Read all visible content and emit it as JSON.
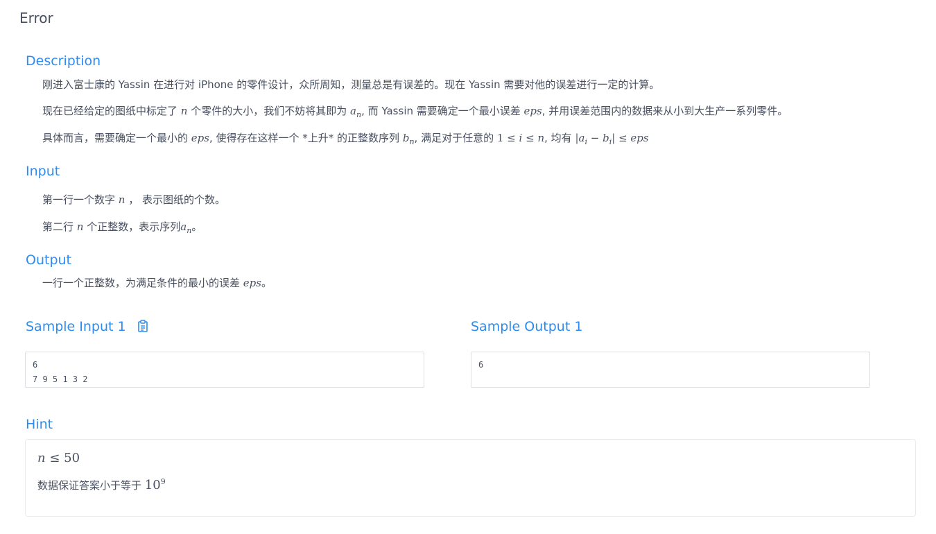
{
  "page": {
    "title": "Error"
  },
  "description": {
    "heading": "Description",
    "p1": "刚进入富士康的 Yassin 在进行对 iPhone 的零件设计，众所周知，测量总是有误差的。现在 Yassin 需要对他的误差进行一定的计算。",
    "p2": {
      "t1": "现在已经给定的图纸中标定了",
      "m1": "n",
      "t2": "个零件的大小，我们不妨将其即为",
      "m2_base": "a",
      "m2_sub": "n",
      "t3": ", 而 Yassin 需要确定一个最小误差",
      "m3": "eps",
      "t4": ", 并用误差范围内的数据来从小到大生产一系列零件。"
    },
    "p3": {
      "t1": "具体而言，需要确定一个最小的",
      "m1": "eps",
      "t2": ", 使得存在这样一个 *上升* 的正整数序列",
      "m2_base": "b",
      "m2_sub": "n",
      "t3": ", 满足对于任意的",
      "m3_a": "1 ≤",
      "m3_b": "i",
      "m3_c": "≤ n",
      "t4": ", 均有",
      "m4_a": "|a",
      "m4_sub1": "i",
      "m4_b": " − b",
      "m4_sub2": "i",
      "m4_c": "| ≤ eps"
    }
  },
  "input": {
    "heading": "Input",
    "p1": {
      "t1": "第一行一个数字",
      "m1": "n",
      "t2": "，  表示图纸的个数。"
    },
    "p2": {
      "t1": "第二行",
      "m1": "n",
      "t2": "个正整数，表示序列",
      "m2_base": "a",
      "m2_sub": "n",
      "t3": "。"
    }
  },
  "output": {
    "heading": "Output",
    "p1": {
      "t1": "一行一个正整数，为满足条件的最小的误差",
      "m1": "eps",
      "t2": "。"
    }
  },
  "samples": {
    "input_title": "Sample Input 1",
    "input_text": "6\n7 9 5 1 3 2",
    "output_title": "Sample Output 1",
    "output_text": "6",
    "copy_icon": "clipboard-icon"
  },
  "hint": {
    "heading": "Hint",
    "line1_a": "n",
    "line1_b": "≤ 50",
    "line2_text": "数据保证答案小于等于",
    "line2_base": "10",
    "line2_sup": "9"
  },
  "colors": {
    "accent": "#2d8cf0",
    "text": "#495060",
    "border": "#dddee1"
  }
}
